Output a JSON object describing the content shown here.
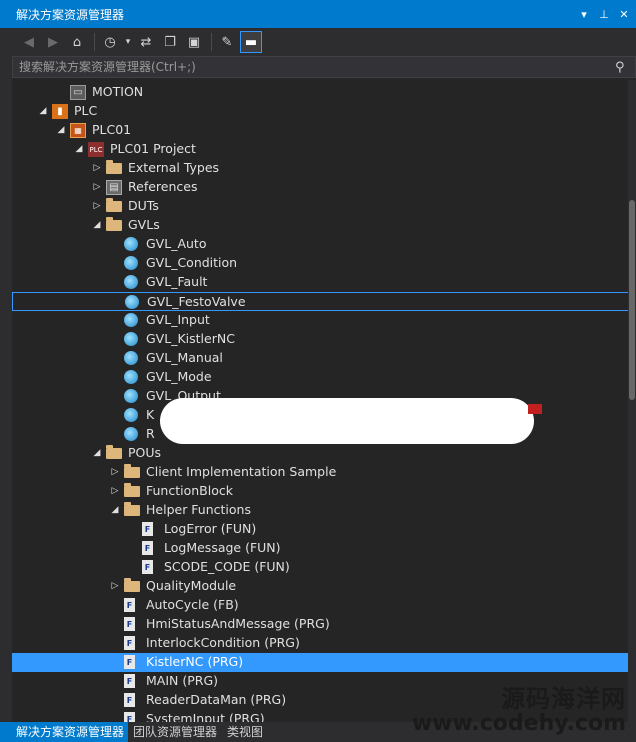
{
  "window": {
    "title": "解决方案资源管理器"
  },
  "toolbar": {
    "icons": [
      "back-icon",
      "forward-icon",
      "home-icon",
      "history-icon",
      "dropdown-icon",
      "sync-icon",
      "copy-icon",
      "view-icon",
      "wrench-icon",
      "minus-icon"
    ]
  },
  "search": {
    "placeholder": "搜索解决方案资源管理器(Ctrl+;)"
  },
  "tree": {
    "rows": [
      {
        "label": "MOTION",
        "depth": 2,
        "expand": "none",
        "icon": "motion"
      },
      {
        "label": "PLC",
        "depth": 1,
        "expand": "open",
        "icon": "plc"
      },
      {
        "label": "PLC01",
        "depth": 2,
        "expand": "open",
        "icon": "plc01"
      },
      {
        "label": "PLC01 Project",
        "depth": 3,
        "expand": "open",
        "icon": "project"
      },
      {
        "label": "External Types",
        "depth": 4,
        "expand": "closed",
        "icon": "folder"
      },
      {
        "label": "References",
        "depth": 4,
        "expand": "closed",
        "icon": "refs"
      },
      {
        "label": "DUTs",
        "depth": 4,
        "expand": "closed",
        "icon": "folder"
      },
      {
        "label": "GVLs",
        "depth": 4,
        "expand": "open",
        "icon": "folder"
      },
      {
        "label": "GVL_Auto",
        "depth": 5,
        "expand": "none",
        "icon": "globe"
      },
      {
        "label": "GVL_Condition",
        "depth": 5,
        "expand": "none",
        "icon": "globe"
      },
      {
        "label": "GVL_Fault",
        "depth": 5,
        "expand": "none",
        "icon": "globe"
      },
      {
        "label": "GVL_FestoValve",
        "depth": 5,
        "expand": "none",
        "icon": "globe",
        "state": "outlined"
      },
      {
        "label": "GVL_Input",
        "depth": 5,
        "expand": "none",
        "icon": "globe"
      },
      {
        "label": "GVL_KistlerNC",
        "depth": 5,
        "expand": "none",
        "icon": "globe"
      },
      {
        "label": "GVL_Manual",
        "depth": 5,
        "expand": "none",
        "icon": "globe"
      },
      {
        "label": "GVL_Mode",
        "depth": 5,
        "expand": "none",
        "icon": "globe"
      },
      {
        "label": "GVL_Output",
        "depth": 5,
        "expand": "none",
        "icon": "globe"
      },
      {
        "label": "K",
        "depth": 5,
        "expand": "none",
        "icon": "globe"
      },
      {
        "label": "R",
        "depth": 5,
        "expand": "none",
        "icon": "globe"
      },
      {
        "label": "POUs",
        "depth": 4,
        "expand": "open",
        "icon": "folder"
      },
      {
        "label": "Client Implementation Sample",
        "depth": 5,
        "expand": "closed",
        "icon": "folder"
      },
      {
        "label": "FunctionBlock",
        "depth": 5,
        "expand": "closed",
        "icon": "folder"
      },
      {
        "label": "Helper Functions",
        "depth": 5,
        "expand": "open",
        "icon": "folder"
      },
      {
        "label": "LogError (FUN)",
        "depth": 6,
        "expand": "none",
        "icon": "doc"
      },
      {
        "label": "LogMessage (FUN)",
        "depth": 6,
        "expand": "none",
        "icon": "doc"
      },
      {
        "label": "SCODE_CODE (FUN)",
        "depth": 6,
        "expand": "none",
        "icon": "doc"
      },
      {
        "label": "QualityModule",
        "depth": 5,
        "expand": "closed",
        "icon": "folder"
      },
      {
        "label": "AutoCycle (FB)",
        "depth": 5,
        "expand": "none",
        "icon": "doc"
      },
      {
        "label": "HmiStatusAndMessage (PRG)",
        "depth": 5,
        "expand": "none",
        "icon": "doc"
      },
      {
        "label": "InterlockCondition (PRG)",
        "depth": 5,
        "expand": "none",
        "icon": "doc"
      },
      {
        "label": "KistlerNC (PRG)",
        "depth": 5,
        "expand": "none",
        "icon": "doc",
        "state": "selected"
      },
      {
        "label": "MAIN (PRG)",
        "depth": 5,
        "expand": "none",
        "icon": "doc"
      },
      {
        "label": "ReaderDataMan (PRG)",
        "depth": 5,
        "expand": "none",
        "icon": "doc"
      },
      {
        "label": "SystemInput (PRG)",
        "depth": 5,
        "expand": "none",
        "icon": "doc"
      }
    ]
  },
  "bottom_tabs": [
    "解决方案资源管理器",
    "团队资源管理器",
    "类视图"
  ],
  "watermark": {
    "line1": "源码海洋网",
    "line2": "www.codehy.com"
  },
  "colors": {
    "accent": "#007acc",
    "selection": "#3399ff",
    "background": "#252526"
  }
}
